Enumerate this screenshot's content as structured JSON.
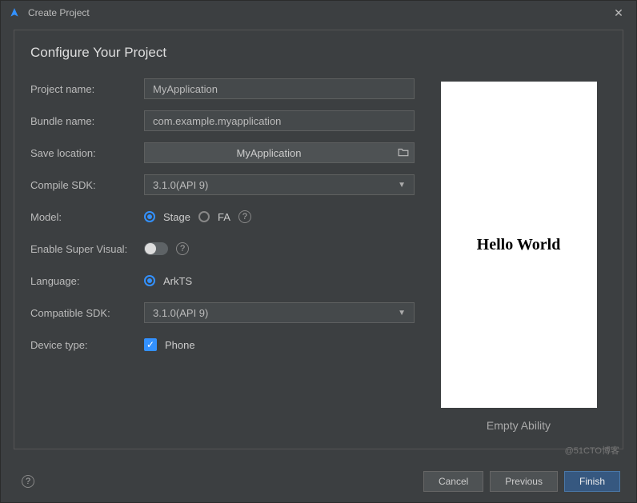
{
  "window": {
    "title": "Create Project"
  },
  "heading": "Configure Your Project",
  "labels": {
    "project_name": "Project name:",
    "bundle_name": "Bundle name:",
    "save_location": "Save location:",
    "compile_sdk": "Compile SDK:",
    "model": "Model:",
    "enable_super_visual": "Enable Super Visual:",
    "language": "Language:",
    "compatible_sdk": "Compatible SDK:",
    "device_type": "Device type:"
  },
  "fields": {
    "project_name": "MyApplication",
    "bundle_name": "com.example.myapplication",
    "save_location": "MyApplication",
    "compile_sdk": "3.1.0(API 9)",
    "compatible_sdk": "3.1.0(API 9)"
  },
  "model_options": {
    "stage": "Stage",
    "fa": "FA"
  },
  "language_option": "ArkTS",
  "device_type_option": "Phone",
  "preview": {
    "text": "Hello World",
    "caption": "Empty Ability"
  },
  "footer": {
    "cancel": "Cancel",
    "previous": "Previous",
    "finish": "Finish"
  },
  "watermark": "@51CTO博客"
}
